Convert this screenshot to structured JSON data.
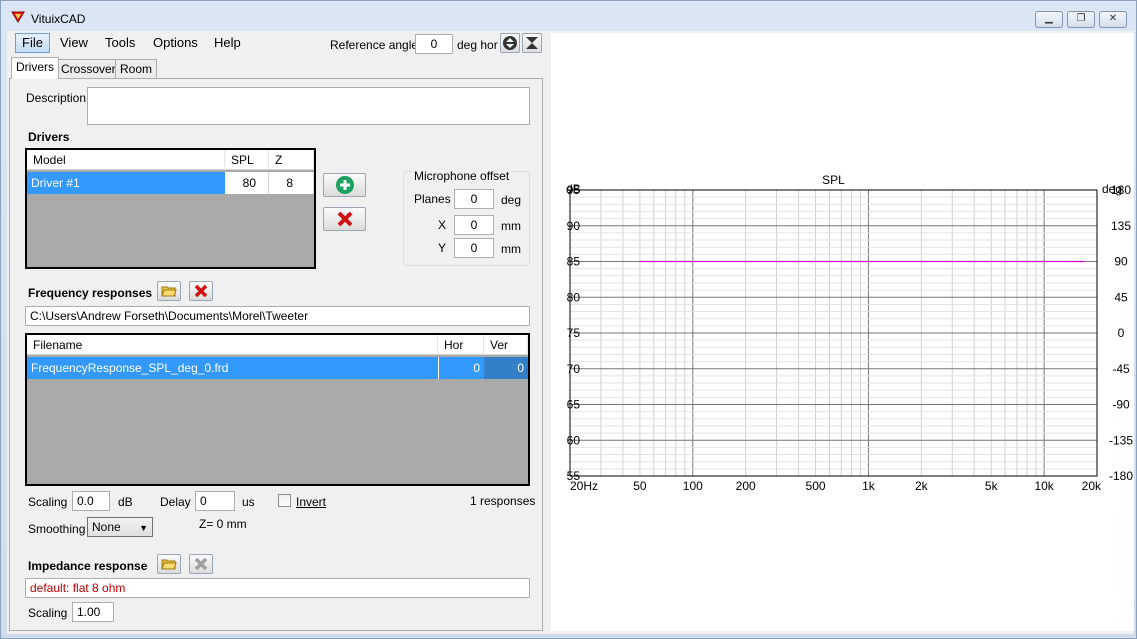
{
  "window": {
    "title": "VituixCAD"
  },
  "menu": [
    "File",
    "View",
    "Tools",
    "Options",
    "Help"
  ],
  "toolbar": {
    "ref_angle_label": "Reference angle",
    "ref_angle_value": "0",
    "ref_angle_unit": "deg hor"
  },
  "tabs": [
    "Drivers",
    "Crossover",
    "Room"
  ],
  "description": {
    "label": "Description",
    "value": ""
  },
  "drivers": {
    "title": "Drivers",
    "columns": [
      "Model",
      "SPL",
      "Z"
    ],
    "rows": [
      {
        "model": "Driver #1",
        "spl": "80",
        "z": "8"
      }
    ]
  },
  "mic_offset": {
    "title": "Microphone offset",
    "planes_label": "Planes",
    "planes_value": "0",
    "planes_unit": "deg",
    "x_label": "X",
    "x_value": "0",
    "x_unit": "mm",
    "y_label": "Y",
    "y_value": "0",
    "y_unit": "mm"
  },
  "freq": {
    "title": "Frequency responses",
    "path": "C:\\Users\\Andrew Forseth\\Documents\\Morel\\Tweeter",
    "columns": [
      "Filename",
      "Hor",
      "Ver"
    ],
    "rows": [
      {
        "filename": "FrequencyResponse_SPL_deg_0.frd",
        "hor": "0",
        "ver": "0"
      }
    ],
    "scaling_label": "Scaling",
    "scaling_value": "0.0",
    "scaling_unit": "dB",
    "delay_label": "Delay",
    "delay_value": "0",
    "delay_unit": "us",
    "invert_label": "Invert",
    "responses_count": "1 responses",
    "smoothing_label": "Smoothing",
    "smoothing_value": "None",
    "z_offset": "Z= 0 mm"
  },
  "impedance": {
    "title": "Impedance response",
    "value": "default: flat 8 ohm",
    "scaling_label": "Scaling",
    "scaling_value": "1.00"
  },
  "colors": {
    "spl_line": "#cc00cc",
    "selection": "#3399ff"
  },
  "chart_data": {
    "type": "line",
    "title": "SPL",
    "xlabel": "",
    "ylabel": "dB",
    "y2label": "deg",
    "xscale": "log",
    "xlim": [
      20,
      20000
    ],
    "ylim": [
      55,
      95
    ],
    "y2lim": [
      -180,
      180
    ],
    "xticks": [
      20,
      50,
      100,
      200,
      500,
      1000,
      2000,
      5000,
      10000,
      20000
    ],
    "xticklabels": [
      "20Hz",
      "50",
      "100",
      "200",
      "500",
      "1k",
      "2k",
      "5k",
      "10k",
      "20k"
    ],
    "yticks": [
      95,
      90,
      85,
      80,
      75,
      70,
      65,
      60,
      55
    ],
    "y2ticks": [
      180,
      135,
      90,
      45,
      0,
      -45,
      -90,
      -135,
      -180
    ],
    "grid": true,
    "series": [
      {
        "x": [
          50,
          100,
          1000,
          10000,
          17000
        ],
        "y": [
          85,
          85,
          85,
          85,
          85
        ]
      }
    ]
  }
}
